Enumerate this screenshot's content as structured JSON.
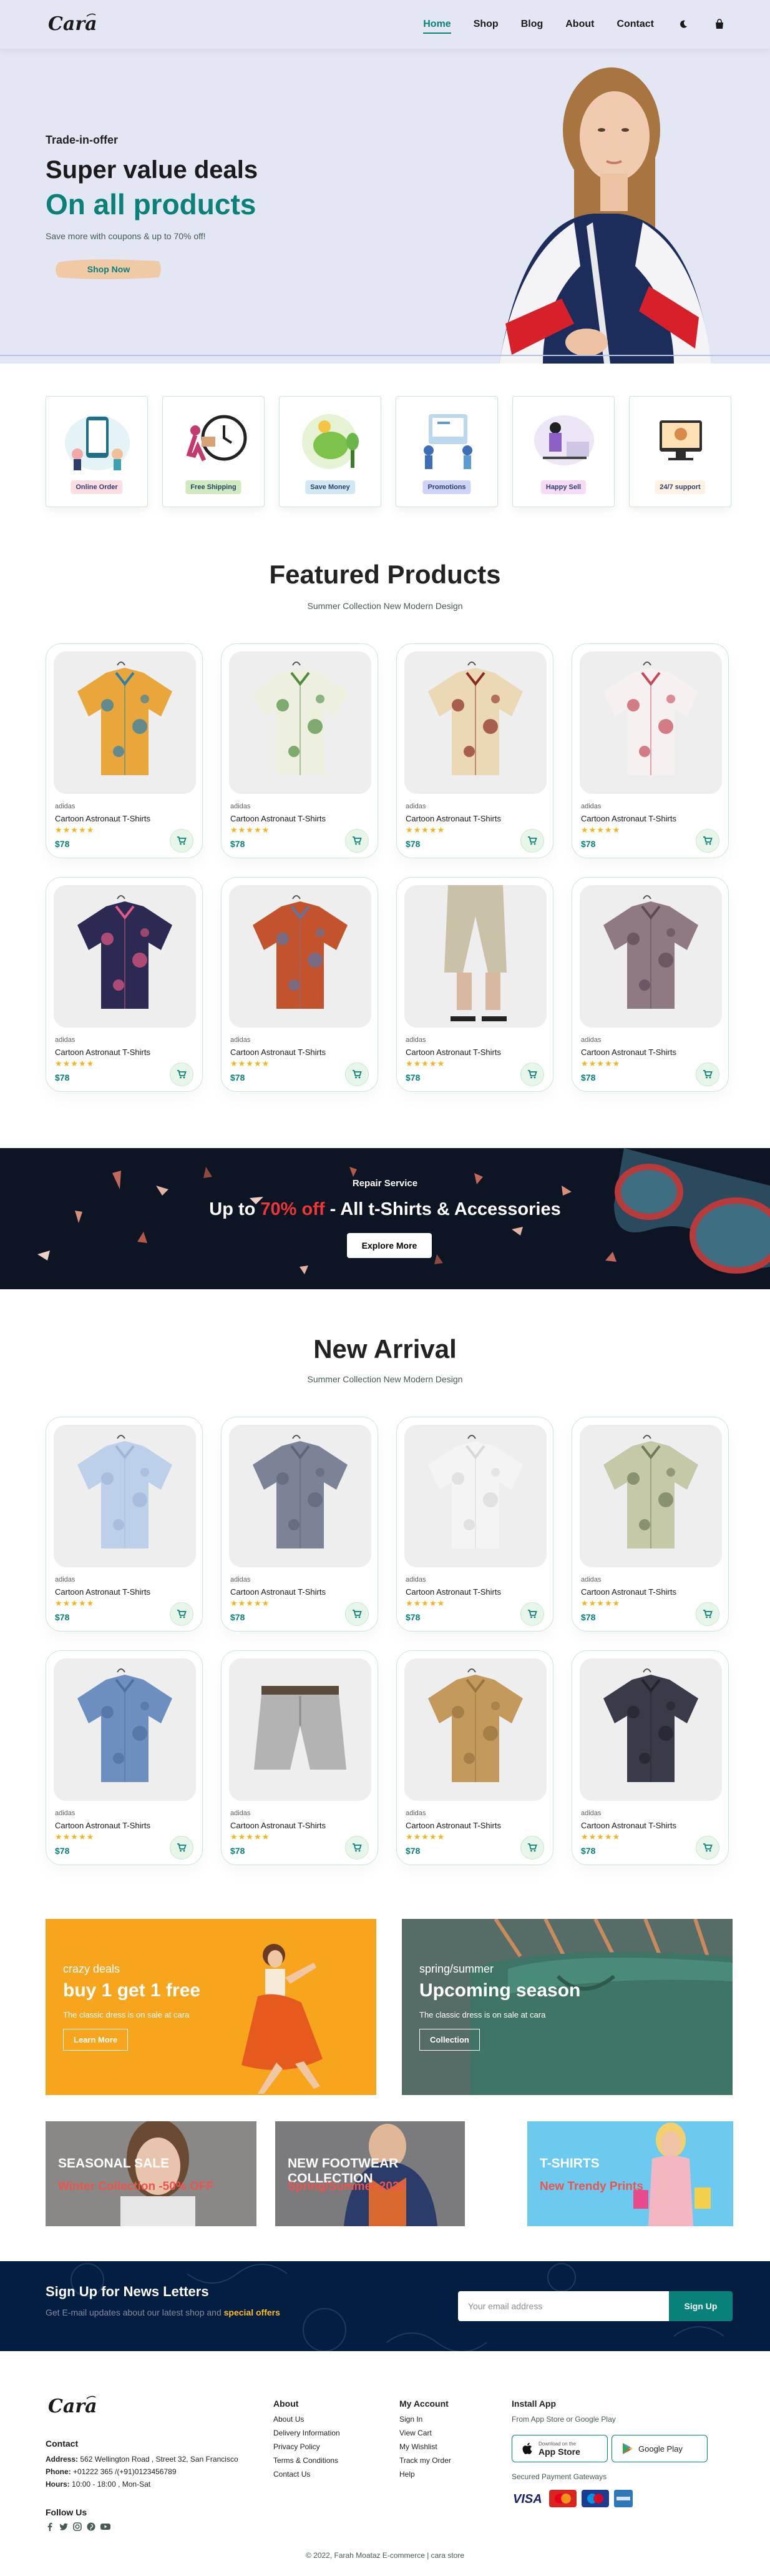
{
  "header": {
    "logo_text": "Cara",
    "nav": [
      {
        "label": "Home",
        "active": true
      },
      {
        "label": "Shop",
        "active": false
      },
      {
        "label": "Blog",
        "active": false
      },
      {
        "label": "About",
        "active": false
      },
      {
        "label": "Contact",
        "active": false
      }
    ],
    "icons": [
      "moon-icon",
      "shopping-bag-icon"
    ],
    "accent_color": "#088178",
    "background": "#e3e6f3"
  },
  "hero": {
    "kicker": "Trade-in-offer",
    "title": "Super value deals",
    "highlight": "On all products",
    "text": "Save more with coupons & up to 70% off!",
    "button": "Shop Now"
  },
  "features": [
    {
      "label": "Online Order",
      "bg": "#fddde4",
      "icon": "online-order-icon"
    },
    {
      "label": "Free Shipping",
      "bg": "#cdebbc",
      "icon": "free-shipping-icon"
    },
    {
      "label": "Save Money",
      "bg": "#d1e8f2",
      "icon": "save-money-icon"
    },
    {
      "label": "Promotions",
      "bg": "#cdd4f8",
      "icon": "promotions-icon"
    },
    {
      "label": "Happy Sell",
      "bg": "#f6dbf6",
      "icon": "happy-sell-icon"
    },
    {
      "label": "24/7 support",
      "bg": "#fff2e5",
      "icon": "support-icon"
    }
  ],
  "featured": {
    "title": "Featured Products",
    "subtitle": "Summer Collection New Modern Design",
    "products": [
      {
        "brand": "adidas",
        "name": "Cartoon Astronaut T-Shirts",
        "stars": "★★★★★",
        "price": "$78",
        "icon": "hawaiian-shirt-icon",
        "colors": [
          "#e9a63b",
          "#2a7fb0"
        ]
      },
      {
        "brand": "adidas",
        "name": "Cartoon Astronaut T-Shirts",
        "stars": "★★★★★",
        "price": "$78",
        "icon": "palm-shirt-icon",
        "colors": [
          "#eef0df",
          "#4f8b3e"
        ]
      },
      {
        "brand": "adidas",
        "name": "Cartoon Astronaut T-Shirts",
        "stars": "★★★★★",
        "price": "$78",
        "icon": "floral-shirt-icon",
        "colors": [
          "#ead9b4",
          "#8b2a1f"
        ]
      },
      {
        "brand": "adidas",
        "name": "Cartoon Astronaut T-Shirts",
        "stars": "★★★★★",
        "price": "$78",
        "icon": "blossom-shirt-icon",
        "colors": [
          "#f6f0f0",
          "#c44a57"
        ]
      },
      {
        "brand": "adidas",
        "name": "Cartoon Astronaut T-Shirts",
        "stars": "★★★★★",
        "price": "$78",
        "icon": "navy-floral-shirt-icon",
        "colors": [
          "#2b2a52",
          "#e25a86"
        ]
      },
      {
        "brand": "adidas",
        "name": "Cartoon Astronaut T-Shirts",
        "stars": "★★★★★",
        "price": "$78",
        "icon": "two-tone-shirt-icon",
        "colors": [
          "#c3532c",
          "#5a78a6"
        ]
      },
      {
        "brand": "adidas",
        "name": "Cartoon Astronaut T-Shirts",
        "stars": "★★★★★",
        "price": "$78",
        "icon": "cropped-pants-icon",
        "colors": [
          "#c9c1a8",
          "#9a9380"
        ]
      },
      {
        "brand": "adidas",
        "name": "Cartoon Astronaut T-Shirts",
        "stars": "★★★★★",
        "price": "$78",
        "icon": "paisley-blouse-icon",
        "colors": [
          "#8f7a84",
          "#5d4a55"
        ]
      }
    ]
  },
  "sale_banner": {
    "kicker": "Repair Service",
    "text_before": "Up to",
    "highlight": "70% off",
    "text_after": "- All t-Shirts & Accessories",
    "button": "Explore More"
  },
  "arrivals": {
    "title": "New Arrival",
    "subtitle": "Summer Collection New Modern Design",
    "products": [
      {
        "brand": "adidas",
        "name": "Cartoon Astronaut T-Shirts",
        "stars": "★★★★★",
        "price": "$78",
        "icon": "light-blue-shirt-icon",
        "colors": [
          "#bcd0ea",
          "#9fb6d6"
        ]
      },
      {
        "brand": "adidas",
        "name": "Cartoon Astronaut T-Shirts",
        "stars": "★★★★★",
        "price": "$78",
        "icon": "gray-shirt-icon",
        "colors": [
          "#7d8396",
          "#5f6578"
        ]
      },
      {
        "brand": "adidas",
        "name": "Cartoon Astronaut T-Shirts",
        "stars": "★★★★★",
        "price": "$78",
        "icon": "white-shirt-icon",
        "colors": [
          "#f4f4f4",
          "#d8d8d8"
        ]
      },
      {
        "brand": "adidas",
        "name": "Cartoon Astronaut T-Shirts",
        "stars": "★★★★★",
        "price": "$78",
        "icon": "print-shirt-icon",
        "colors": [
          "#c6c9a8",
          "#6e7a5a"
        ]
      },
      {
        "brand": "adidas",
        "name": "Cartoon Astronaut T-Shirts",
        "stars": "★★★★★",
        "price": "$78",
        "icon": "denim-shirt-icon",
        "colors": [
          "#6d8fc0",
          "#4e6fa0"
        ]
      },
      {
        "brand": "adidas",
        "name": "Cartoon Astronaut T-Shirts",
        "stars": "★★★★★",
        "price": "$78",
        "icon": "gray-shorts-icon",
        "colors": [
          "#b3b3b3",
          "#8d8d8d"
        ]
      },
      {
        "brand": "adidas",
        "name": "Cartoon Astronaut T-Shirts",
        "stars": "★★★★★",
        "price": "$78",
        "icon": "khaki-jacket-icon",
        "colors": [
          "#c39a5c",
          "#9a7440"
        ]
      },
      {
        "brand": "adidas",
        "name": "Cartoon Astronaut T-Shirts",
        "stars": "★★★★★",
        "price": "$78",
        "icon": "dark-shirt-icon",
        "colors": [
          "#3a3b48",
          "#22232d"
        ]
      }
    ]
  },
  "sm_banners": [
    {
      "kicker": "crazy deals",
      "title": "buy 1 get 1 free",
      "text": "The classic dress is on sale at cara",
      "button": "Learn More"
    },
    {
      "kicker": "spring/summer",
      "title": "Upcoming season",
      "text": "The classic dress is on sale at cara",
      "button": "Collection"
    }
  ],
  "banner3": [
    {
      "title": "SEASONAL SALE",
      "sub": "Winter Collection -50% OFF"
    },
    {
      "title": "NEW FOOTWEAR COLLECTION",
      "sub": "Spring/Summer 2022"
    },
    {
      "title": "T-SHIRTS",
      "sub": "New Trendy Prints"
    }
  ],
  "newsletter": {
    "title": "Sign Up for News Letters",
    "text_before": "Get E-mail updates about our latest shop and",
    "highlight": "special offers",
    "placeholder": "Your email address",
    "button": "Sign Up"
  },
  "footer": {
    "contact_title": "Contact",
    "address_label": "Address:",
    "address": "562 Wellington Road , Street 32, San Francisco",
    "phone_label": "Phone:",
    "phone": "+01222 365 /(+91)0123456789",
    "hours_label": "Hours:",
    "hours": "10:00 - 18:00 , Mon-Sat",
    "follow": "Follow Us",
    "social_icons": [
      "facebook-icon",
      "twitter-icon",
      "instagram-icon",
      "pinterest-icon",
      "youtube-icon"
    ],
    "about_title": "About",
    "about_links": [
      "About Us",
      "Delivery Information",
      "Privacy Policy",
      "Terms & Conditions",
      "Contact Us"
    ],
    "account_title": "My Account",
    "account_links": [
      "Sign In",
      "View Cart",
      "My Wishlist",
      "Track my Order",
      "Help"
    ],
    "install_title": "Install App",
    "install_text": "From App Store or Google Play",
    "app_store": "App Store",
    "app_store_small": "Download on the",
    "google_play": "Google Play",
    "payment_text": "Secured Payment Gateways",
    "copyright": "© 2022, Farah Moataz E-commerce | cara store"
  }
}
